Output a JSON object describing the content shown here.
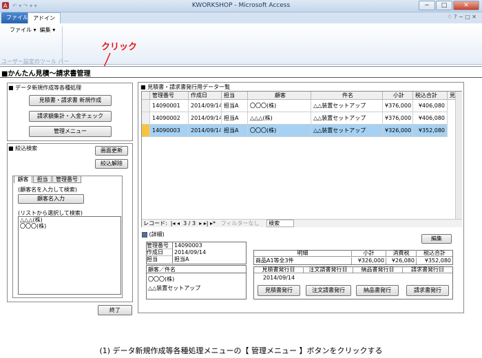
{
  "window": {
    "title": "KWORKSHOP - Microsoft Access",
    "controls": [
      "−",
      "□",
      "✕"
    ]
  },
  "ribbon": {
    "tabs": [
      "ファイル",
      "アドイン"
    ],
    "menus": [
      "ファイル ▾",
      "編集 ▾"
    ],
    "group_label": "ユーザー設定のツール バー",
    "right_icons": "♢ ? − □ ✕"
  },
  "annotation": {
    "text": "クリック",
    "color": "#e8111b"
  },
  "form": {
    "title": "かんたん見積〜請求書管理",
    "process_section": {
      "label": "■ データ新規作成等各種処理",
      "buttons": [
        "見積書・請求書 新規作成",
        "請求額集計・入金チェック",
        "管理メニュー"
      ]
    },
    "filter_section": {
      "label": "■ 絞込検索",
      "refresh_button": "画面更新",
      "clear_button": "絞込解除",
      "tabs": [
        "顧客",
        "担当",
        "管理番号"
      ],
      "hint_input": "(顧客名を入力して検索)",
      "customer_input_button": "顧客名入力",
      "hint_list": "(リストから選択して検索)",
      "list_items": [
        "△△△(株)",
        "〇〇〇(株)"
      ]
    },
    "exit_button": "終了",
    "datasheet": {
      "label": "■ 見積書・請求書発行用データ一覧",
      "columns": [
        "管理番号",
        "作成日",
        "担当",
        "顧客",
        "件名",
        "小計",
        "税込合計",
        "見積"
      ],
      "rows": [
        [
          "14090001",
          "2014/09/14",
          "担当A",
          "〇〇〇(株)",
          "△△装置セットアップ",
          "¥376,000",
          "¥406,080"
        ],
        [
          "14090002",
          "2014/09/14",
          "担当A",
          "△△△(株)",
          "△△装置セットアップ",
          "¥376,000",
          "¥406,080"
        ],
        [
          "14090003",
          "2014/09/14",
          "担当A",
          "〇〇〇(株)",
          "△△装置セットアップ",
          "¥326,000",
          "¥352,080"
        ]
      ],
      "selected_row": 2,
      "nav": {
        "record_label": "レコード:",
        "position": "3 / 3",
        "filter_status": "フィルターなし",
        "search_label": "検索"
      }
    },
    "detail": {
      "label": "(詳細)",
      "edit_button": "編集",
      "fields": [
        {
          "name": "管理番号",
          "value": "14090003"
        },
        {
          "name": "作成日",
          "value": "2014/09/14"
        },
        {
          "name": "担当",
          "value": "担当A"
        }
      ],
      "customer_header": "顧客／件名",
      "customer": "〇〇〇(株)",
      "subject": "△△装置セットアップ",
      "breakdown": {
        "header": "明細",
        "cols": [
          "小計",
          "消費税",
          "税込合計"
        ],
        "item": "商品A1等全3件",
        "subtotal": "¥326,000",
        "tax": "¥26,080",
        "total": "¥352,080"
      },
      "issue_cols": [
        "見積書発行日",
        "注文請書発行日",
        "納品書発行日",
        "請求書発行日"
      ],
      "issue_dates": [
        "2014/09/14",
        "",
        "",
        ""
      ],
      "issue_buttons": [
        "見積書発行",
        "注文請書発行",
        "納品書発行",
        "請求書発行"
      ]
    }
  },
  "caption": "(1) データ新規作成等各種処理メニューの【 管理メニュー 】ボタンをクリックする"
}
